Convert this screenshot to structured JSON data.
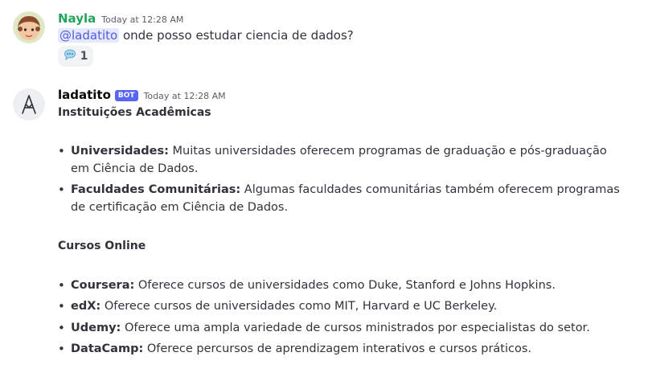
{
  "messages": [
    {
      "author": "Nayla",
      "author_color": "#23a559",
      "timestamp": "Today at 12:28 AM",
      "mention": "@ladatito",
      "text": "onde posso estudar ciencia de dados?",
      "reaction": {
        "icon": "speech-balloon-icon",
        "count": "1"
      }
    },
    {
      "author": "ladatito",
      "author_color": "#060607",
      "badge": "BOT",
      "timestamp": "Today at 12:28 AM",
      "sections": [
        {
          "heading": "Instituições Acadêmicas",
          "items": [
            {
              "term": "Universidades:",
              "desc": "Muitas universidades oferecem programas de graduação e pós-graduação em Ciência de Dados."
            },
            {
              "term": "Faculdades Comunitárias:",
              "desc": "Algumas faculdades comunitárias também oferecem programas de certificação em Ciência de Dados."
            }
          ]
        },
        {
          "heading": "Cursos Online",
          "items": [
            {
              "term": "Coursera:",
              "desc": "Oferece cursos de universidades como Duke, Stanford e Johns Hopkins."
            },
            {
              "term": "edX:",
              "desc": "Oferece cursos de universidades como MIT, Harvard e UC Berkeley."
            },
            {
              "term": "Udemy:",
              "desc": "Oferece uma ampla variedade de cursos ministrados por especialistas do setor."
            },
            {
              "term": "DataCamp:",
              "desc": "Oferece percursos de aprendizagem interativos e cursos práticos."
            }
          ]
        }
      ]
    }
  ],
  "bullet_char": "•"
}
